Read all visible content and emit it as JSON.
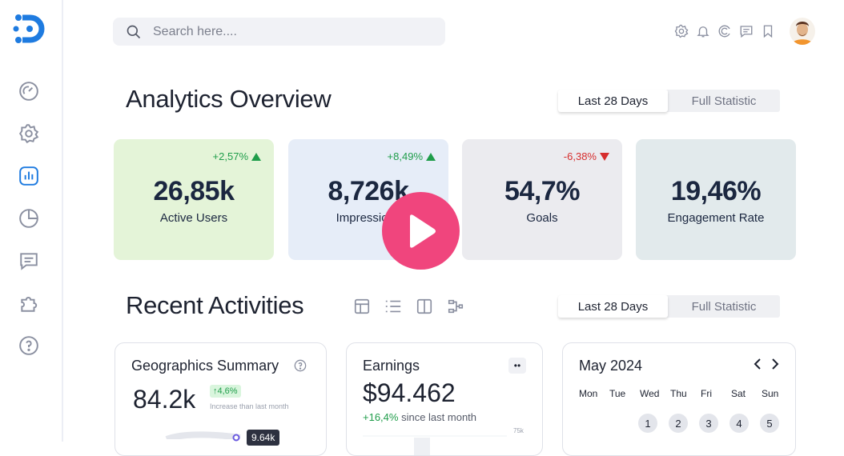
{
  "search": {
    "placeholder": "Search here...."
  },
  "overview": {
    "title": "Analytics Overview",
    "range_active": "Last 28 Days",
    "range_other": "Full Statistic"
  },
  "stats": [
    {
      "value": "26,85k",
      "label": "Active Users",
      "trend": "+2,57%",
      "direction": "up",
      "bg": "#e4f4d8"
    },
    {
      "value": "8,726k",
      "label": "Impressions",
      "trend": "+8,49%",
      "direction": "up",
      "bg": "#e6edf8"
    },
    {
      "value": "54,7%",
      "label": "Goals",
      "trend": "-6,38%",
      "direction": "down",
      "bg": "#ebebef"
    },
    {
      "value": "19,46%",
      "label": "Engagement Rate",
      "trend": "",
      "direction": "",
      "bg": "#e2eaec"
    }
  ],
  "activities": {
    "title": "Recent Activities",
    "range_active": "Last 28 Days",
    "range_other": "Full Statistic"
  },
  "geo": {
    "title": "Geographics Summary",
    "value": "84.2k",
    "badge": "↑4,6%",
    "note": "Increase than last month",
    "tooltip": "9.64k"
  },
  "earnings": {
    "title": "Earnings",
    "value": "$94.462",
    "change": "+16,4%",
    "change_note": "since last month",
    "axis_top": "75k",
    "menu": "••"
  },
  "calendar": {
    "month": "May 2024",
    "prev": "‹",
    "next": "›",
    "weekdays": [
      "Mon",
      "Tue",
      "Wed",
      "Thu",
      "Fri",
      "Sat",
      "Sun"
    ],
    "days": [
      "1",
      "2",
      "3",
      "4",
      "5"
    ]
  },
  "colors": {
    "accent": "#1e7be0",
    "play": "#f0457d",
    "up": "#1f9d4a",
    "down": "#d62d2d"
  }
}
